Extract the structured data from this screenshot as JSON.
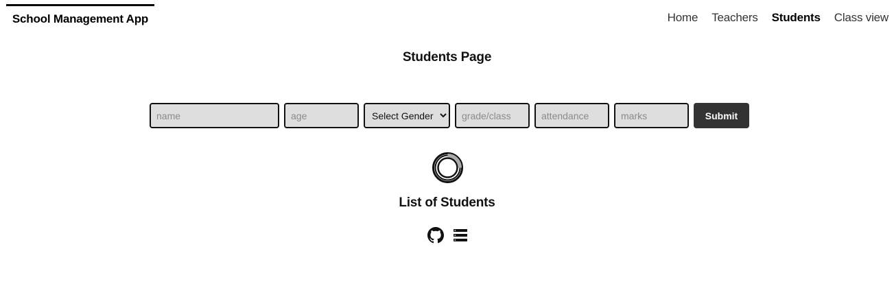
{
  "header": {
    "brand": "School Management App",
    "nav": [
      {
        "label": "Home",
        "active": false
      },
      {
        "label": "Teachers",
        "active": false
      },
      {
        "label": "Students",
        "active": true
      },
      {
        "label": "Class view",
        "active": false
      }
    ]
  },
  "main": {
    "title": "Students Page",
    "form": {
      "name_placeholder": "name",
      "age_placeholder": "age",
      "gender_selected": "Select Gender",
      "grade_placeholder": "grade/class",
      "attendance_placeholder": "attendance",
      "marks_placeholder": "marks",
      "submit_label": "Submit"
    },
    "loading": true,
    "list_title": "List of Students"
  },
  "footer": {
    "icons": [
      "github-icon",
      "list-icon"
    ]
  },
  "colors": {
    "input_bg": "#dedede",
    "button_bg": "#333333",
    "text": "#111111"
  }
}
